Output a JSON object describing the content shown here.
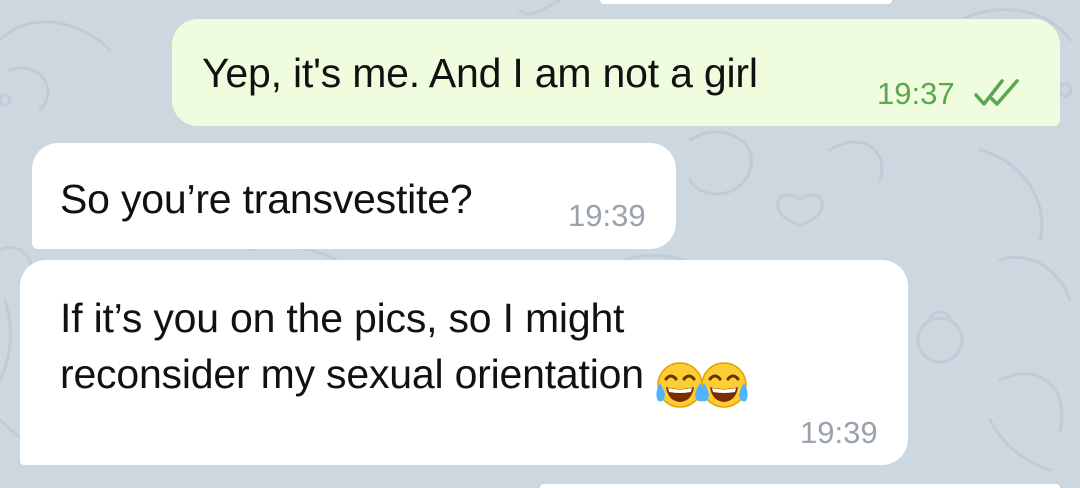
{
  "chat": {
    "background_color": "#cdd7e0",
    "outgoing_bubble_color": "#effdde",
    "incoming_bubble_color": "#ffffff",
    "outgoing_time_color": "#5aa74f",
    "incoming_time_color": "#9aa3ab",
    "messages": [
      {
        "direction": "outgoing",
        "text": "Yep, it's me. And I am not a girl",
        "time": "19:37",
        "status_icon": "double-check-icon"
      },
      {
        "direction": "incoming",
        "text": "So you’re transvestite?",
        "time": "19:39"
      },
      {
        "direction": "incoming",
        "text_lines": [
          "If it’s you on the pics, so I might",
          "reconsider my sexual orientation"
        ],
        "emoji": [
          "face-with-tears-of-joy-icon",
          "face-with-tears-of-joy-icon"
        ],
        "time": "19:39"
      }
    ]
  }
}
